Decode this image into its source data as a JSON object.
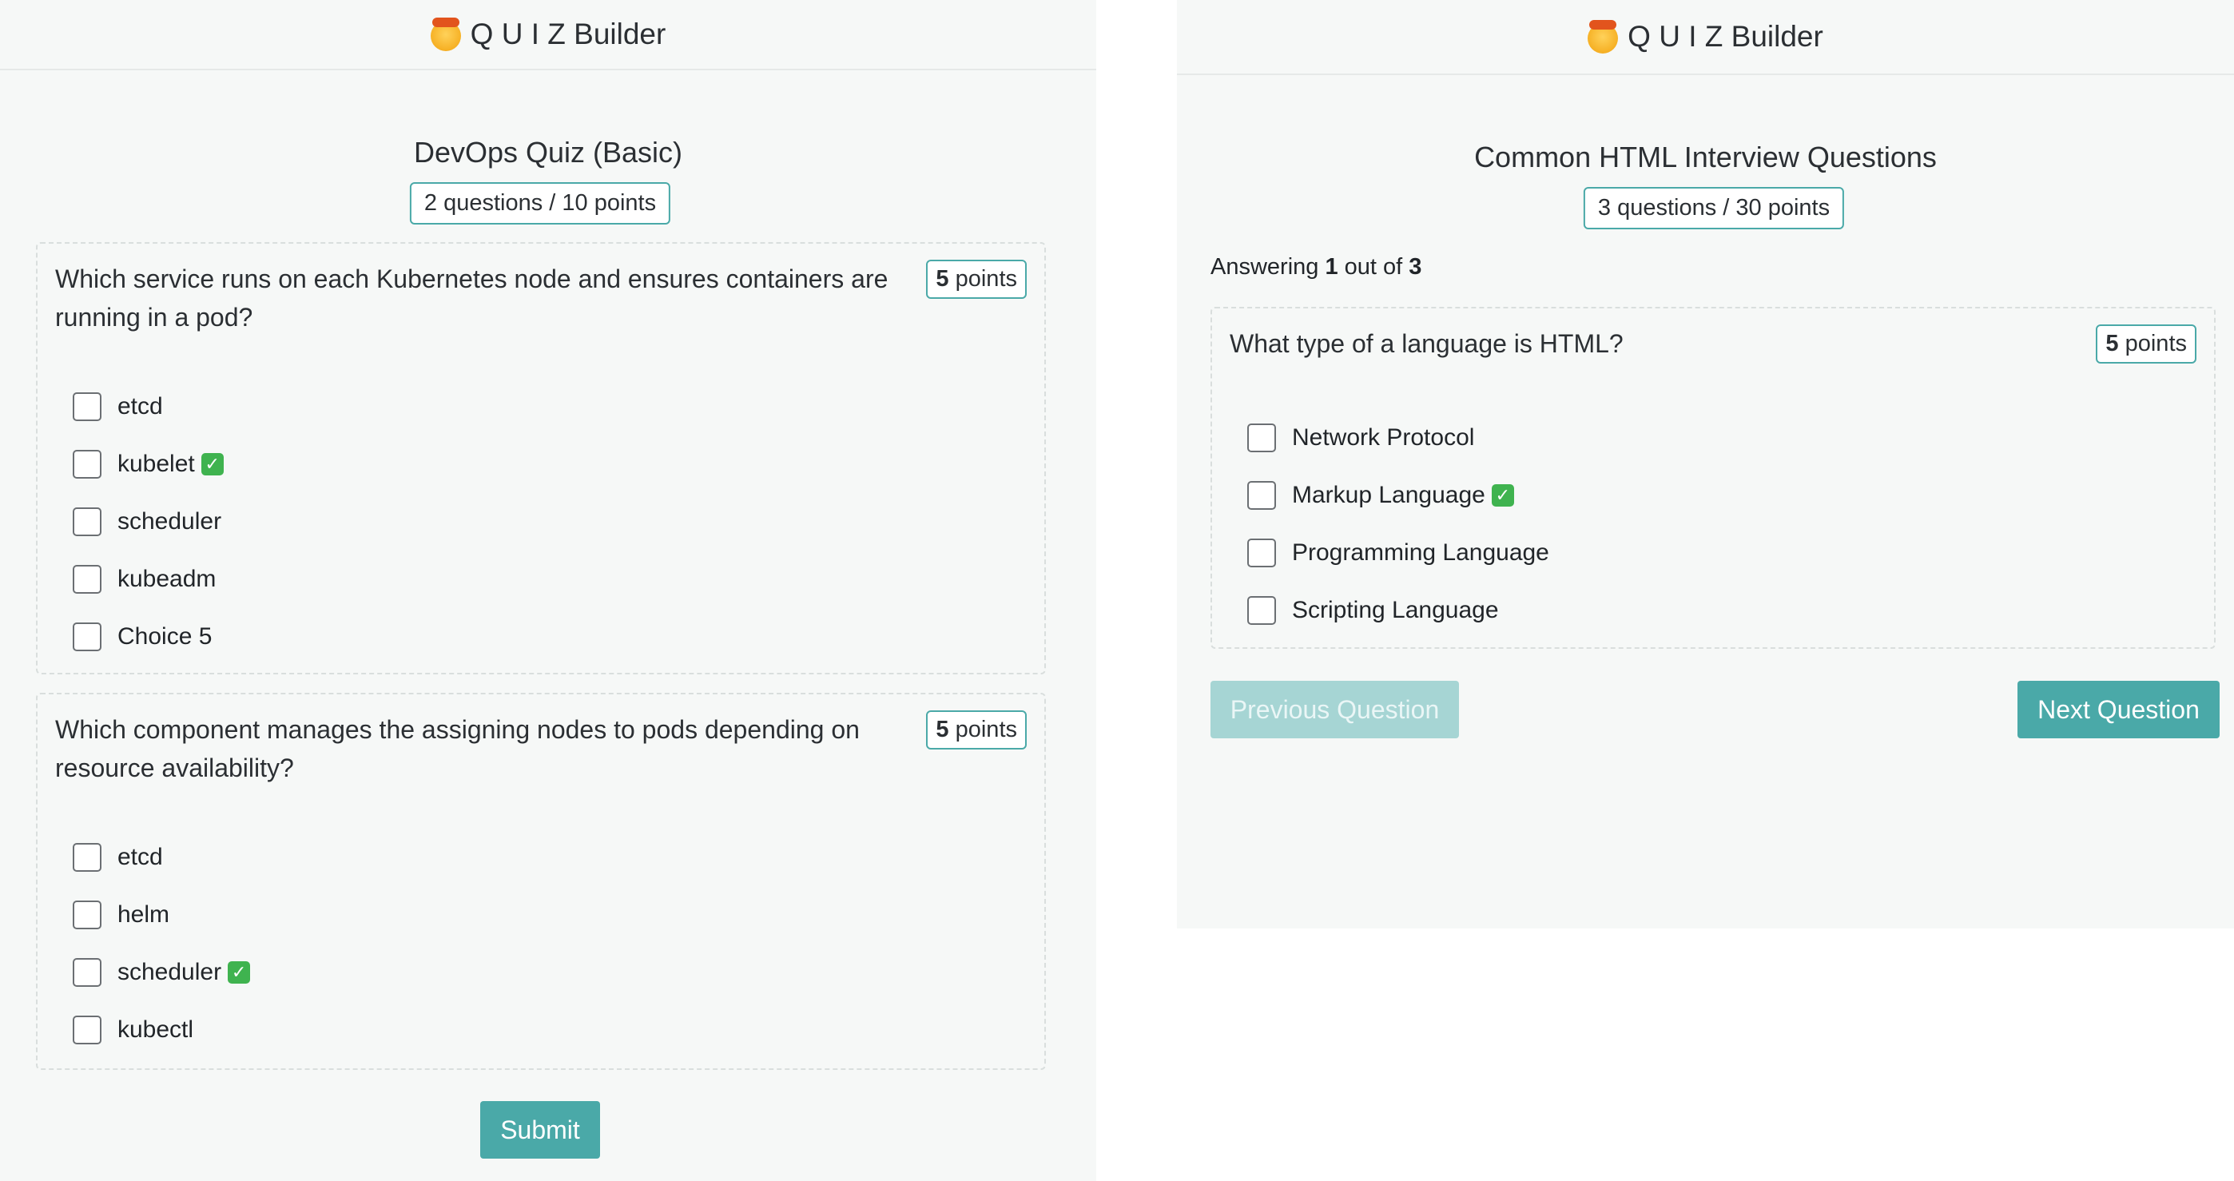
{
  "left": {
    "brand": "Q U I Z Builder",
    "quiz_title": "DevOps Quiz (Basic)",
    "quiz_badge": "2 questions / 10 points",
    "questions": [
      {
        "text": "Which service runs on each Kubernetes node and ensures containers are running in a pod?",
        "points_value": "5",
        "points_label": "points",
        "choices": [
          {
            "label": "etcd",
            "correct": false
          },
          {
            "label": "kubelet",
            "correct": true
          },
          {
            "label": "scheduler",
            "correct": false
          },
          {
            "label": "kubeadm",
            "correct": false
          },
          {
            "label": "Choice 5",
            "correct": false
          }
        ]
      },
      {
        "text": "Which component manages the assigning nodes to pods depending on resource availability?",
        "points_value": "5",
        "points_label": "points",
        "choices": [
          {
            "label": "etcd",
            "correct": false
          },
          {
            "label": "helm",
            "correct": false
          },
          {
            "label": "scheduler",
            "correct": true
          },
          {
            "label": "kubectl",
            "correct": false
          }
        ]
      }
    ],
    "submit_label": "Submit"
  },
  "right": {
    "brand": "Q U I Z Builder",
    "quiz_title": "Common HTML Interview Questions",
    "quiz_badge": "3 questions / 30 points",
    "progress": {
      "prefix": "Answering",
      "current": "1",
      "middle": "out of",
      "total": "3"
    },
    "question": {
      "text": "What type of a language is HTML?",
      "points_value": "5",
      "points_label": "points",
      "choices": [
        {
          "label": "Network Protocol",
          "correct": false
        },
        {
          "label": "Markup Language",
          "correct": true
        },
        {
          "label": "Programming Language",
          "correct": false
        },
        {
          "label": "Scripting Language",
          "correct": false
        }
      ]
    },
    "prev_label": "Previous Question",
    "next_label": "Next Question"
  },
  "colors": {
    "accent": "#4aa9a8",
    "correct_mark": "#3fb34f",
    "panel_bg": "#f6f8f7"
  },
  "icons": {
    "brand": "exploding-head-icon",
    "correct": "check-mark-icon"
  }
}
